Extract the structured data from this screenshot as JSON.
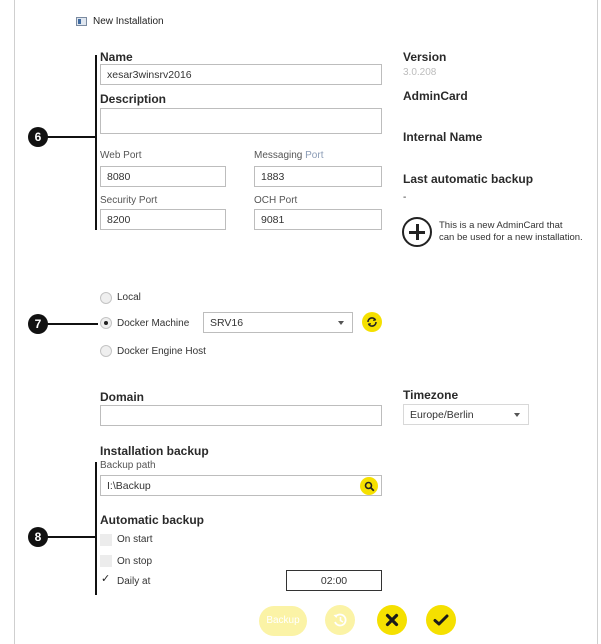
{
  "window": {
    "title": "New Installation",
    "icon": "app-window-icon"
  },
  "form": {
    "name_label": "Name",
    "name_value": "xesar3winsrv2016",
    "description_label": "Description",
    "description_value": "",
    "web_port_label": "Web Port",
    "web_port_value": "8080",
    "messaging_port_label_a": "Messaging ",
    "messaging_port_label_b": "Port",
    "messaging_port_value": "1883",
    "security_port_label": "Security Port",
    "security_port_value": "8200",
    "och_port_label": "OCH Port",
    "och_port_value": "9081"
  },
  "info": {
    "version_label": "Version",
    "version_value": "3.0.208",
    "admincard_label": "AdminCard",
    "internal_name_label": "Internal Name",
    "last_backup_label": "Last automatic backup",
    "last_backup_value": "-",
    "new_card_text_1": "This is a new AdminCard that",
    "new_card_text_2": "can be used for a new installation."
  },
  "host": {
    "options": [
      "Local",
      "Docker Machine",
      "Docker Engine Host"
    ],
    "selected": "Docker Machine",
    "machine_value": "SRV16"
  },
  "domain": {
    "label": "Domain",
    "value": ""
  },
  "timezone": {
    "label": "Timezone",
    "value": "Europe/Berlin"
  },
  "backup": {
    "section_label": "Installation backup",
    "path_label": "Backup path",
    "path_value": "I:\\Backup",
    "auto_label": "Automatic backup",
    "on_start_label": "On start",
    "on_stop_label": "On stop",
    "daily_label": "Daily at",
    "daily_check": "✓",
    "daily_time": "02:00"
  },
  "actions": {
    "backup_label": "Backup"
  },
  "callouts": [
    "6",
    "7",
    "8"
  ],
  "colors": {
    "accent": "#f5e000",
    "accent_faded": "#fbf3a6",
    "callout": "#111111"
  }
}
